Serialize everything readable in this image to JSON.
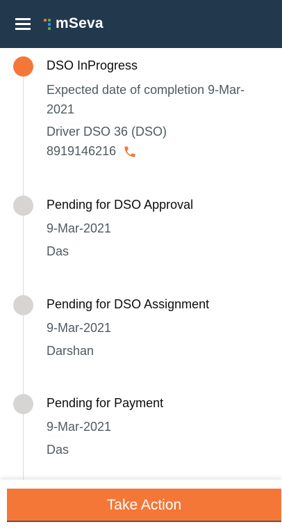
{
  "header": {
    "brand": "mSeva",
    "menu_icon": "hamburger-menu-icon",
    "logo_icon": "mseva-dots-logo",
    "background": "#22394d"
  },
  "timeline": {
    "active_color": "#f47738",
    "pending_color": "#d6d5d4",
    "steps": [
      {
        "status": "DSO InProgress",
        "state": "active",
        "expected_label": "Expected date of completion 9-Mar-2021",
        "assignee": "Driver DSO 36 (DSO)",
        "phone": "8919146216",
        "phone_icon": "phone-icon"
      },
      {
        "status": "Pending for DSO Approval",
        "state": "pending",
        "date": "9-Mar-2021",
        "user": "Das"
      },
      {
        "status": "Pending for DSO Assignment",
        "state": "pending",
        "date": "9-Mar-2021",
        "user": "Darshan"
      },
      {
        "status": "Pending for Payment",
        "state": "pending",
        "date": "9-Mar-2021",
        "user": "Das"
      }
    ]
  },
  "footer": {
    "action_label": "Take Action",
    "action_color": "#f47738"
  }
}
